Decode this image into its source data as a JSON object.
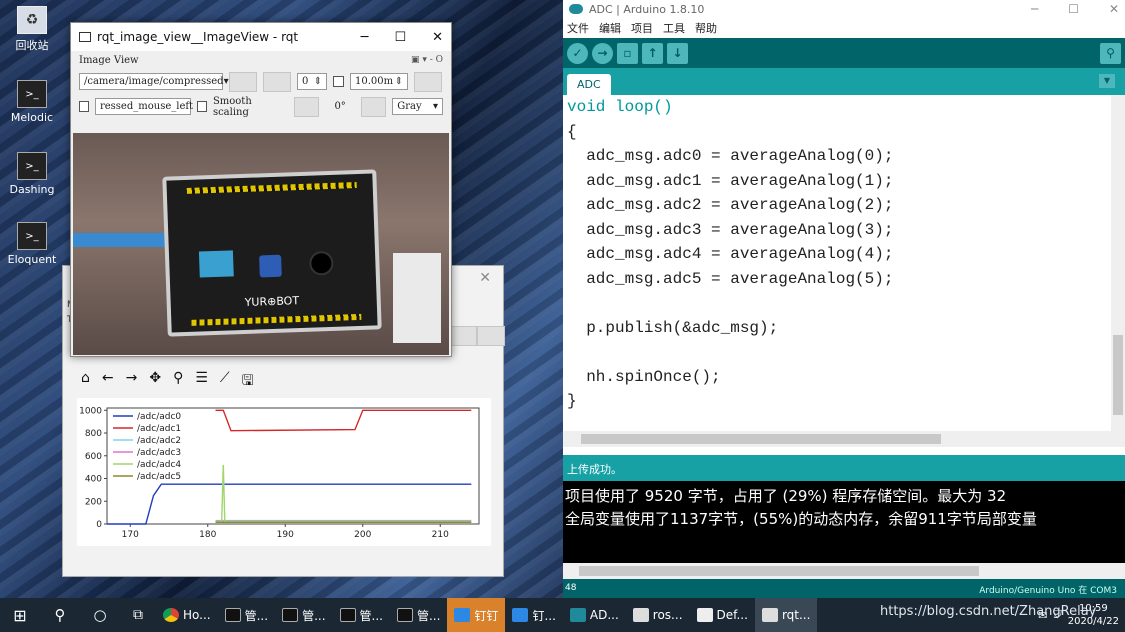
{
  "desktop": {
    "icons": [
      {
        "label": "回收站"
      },
      {
        "label": "Melodic"
      },
      {
        "label": "Dashing"
      },
      {
        "label": "Eloquent"
      }
    ]
  },
  "rqt": {
    "title": "rqt_image_view__ImageView - rqt",
    "panel_label": "Image View",
    "topic": "/camera/image/compressed",
    "spin_value": "0",
    "rate_value": "10.00m",
    "mouse_topic": "ressed_mouse_left",
    "smooth_label": "Smooth scaling",
    "rotation": "0°",
    "color_scheme": "Gray",
    "board_brand": "YUR⊕BOT"
  },
  "plot": {
    "side_letters": [
      "M",
      "To"
    ],
    "toolbar_icons": [
      "home-icon",
      "back-icon",
      "forward-icon",
      "pan-icon",
      "zoom-icon",
      "configure-icon",
      "edit-curve-icon",
      "save-icon"
    ]
  },
  "chart_data": {
    "type": "line",
    "x": [
      168,
      172,
      173,
      181,
      182,
      182.5,
      199,
      200,
      214
    ],
    "xlim": [
      167,
      215
    ],
    "ylim": [
      0,
      1020
    ],
    "xticks": [
      170,
      180,
      190,
      200,
      210
    ],
    "yticks": [
      0,
      200,
      400,
      600,
      800,
      1000
    ],
    "legend_position": "top-left",
    "series": [
      {
        "name": "/adc/adc0",
        "color": "#1f3fbf",
        "points": [
          [
            167,
            0
          ],
          [
            172,
            0
          ],
          [
            173,
            250
          ],
          [
            174,
            350
          ],
          [
            182,
            350
          ],
          [
            214,
            350
          ]
        ]
      },
      {
        "name": "/adc/adc1",
        "color": "#d62728",
        "points": [
          [
            181,
            1000
          ],
          [
            182,
            1000
          ],
          [
            183,
            820
          ],
          [
            199,
            830
          ],
          [
            200,
            1000
          ],
          [
            214,
            1000
          ]
        ]
      },
      {
        "name": "/adc/adc2",
        "color": "#7fd3e8",
        "points": [
          [
            181,
            30
          ],
          [
            214,
            30
          ]
        ]
      },
      {
        "name": "/adc/adc3",
        "color": "#e377c2",
        "points": [
          [
            181,
            25
          ],
          [
            214,
            25
          ]
        ]
      },
      {
        "name": "/adc/adc4",
        "color": "#9fd66b",
        "points": [
          [
            181,
            20
          ],
          [
            181.8,
            20
          ],
          [
            182,
            520
          ],
          [
            182.2,
            20
          ],
          [
            214,
            20
          ]
        ]
      },
      {
        "name": "/adc/adc5",
        "color": "#8c8c2c",
        "points": [
          [
            181,
            15
          ],
          [
            214,
            15
          ]
        ]
      }
    ]
  },
  "arduino": {
    "title": "ADC | Arduino 1.8.10",
    "menu": [
      "文件",
      "编辑",
      "项目",
      "工具",
      "帮助"
    ],
    "tab": "ADC",
    "code": [
      "void loop()",
      "{",
      "  adc_msg.adc0 = averageAnalog(0);",
      "  adc_msg.adc1 = averageAnalog(1);",
      "  adc_msg.adc2 = averageAnalog(2);",
      "  adc_msg.adc3 = averageAnalog(3);",
      "  adc_msg.adc4 = averageAnalog(4);",
      "  adc_msg.adc5 = averageAnalog(5);",
      "",
      "  p.publish(&adc_msg);",
      "",
      "  nh.spinOnce();",
      "}"
    ],
    "status": "上传成功。",
    "console": [
      "项目使用了 9520 字节，占用了 (29%) 程序存储空间。最大为 32",
      "全局变量使用了1137字节，(55%)的动态内存，余留911字节局部变量"
    ],
    "line_number": "48",
    "board": "Arduino/Genuino Uno 在 COM3"
  },
  "taskbar": {
    "items": [
      {
        "label": "Ho...",
        "icon": "chrome-icon"
      },
      {
        "label": "管...",
        "icon": "terminal-icon"
      },
      {
        "label": "管...",
        "icon": "terminal-icon"
      },
      {
        "label": "管...",
        "icon": "terminal-icon"
      },
      {
        "label": "管...",
        "icon": "terminal-icon"
      },
      {
        "label": "钉钉",
        "icon": "dingtalk-icon"
      },
      {
        "label": "钉...",
        "icon": "dingtalk-icon"
      },
      {
        "label": "AD...",
        "icon": "arduino-icon"
      },
      {
        "label": "ros...",
        "icon": "ros-icon"
      },
      {
        "label": "Def...",
        "icon": "grid-icon"
      },
      {
        "label": "rqt...",
        "icon": "rqt-icon"
      }
    ],
    "time": "10:59",
    "date": "2020/4/22",
    "watermark": "https://blog.csdn.net/ZhangRelay"
  }
}
